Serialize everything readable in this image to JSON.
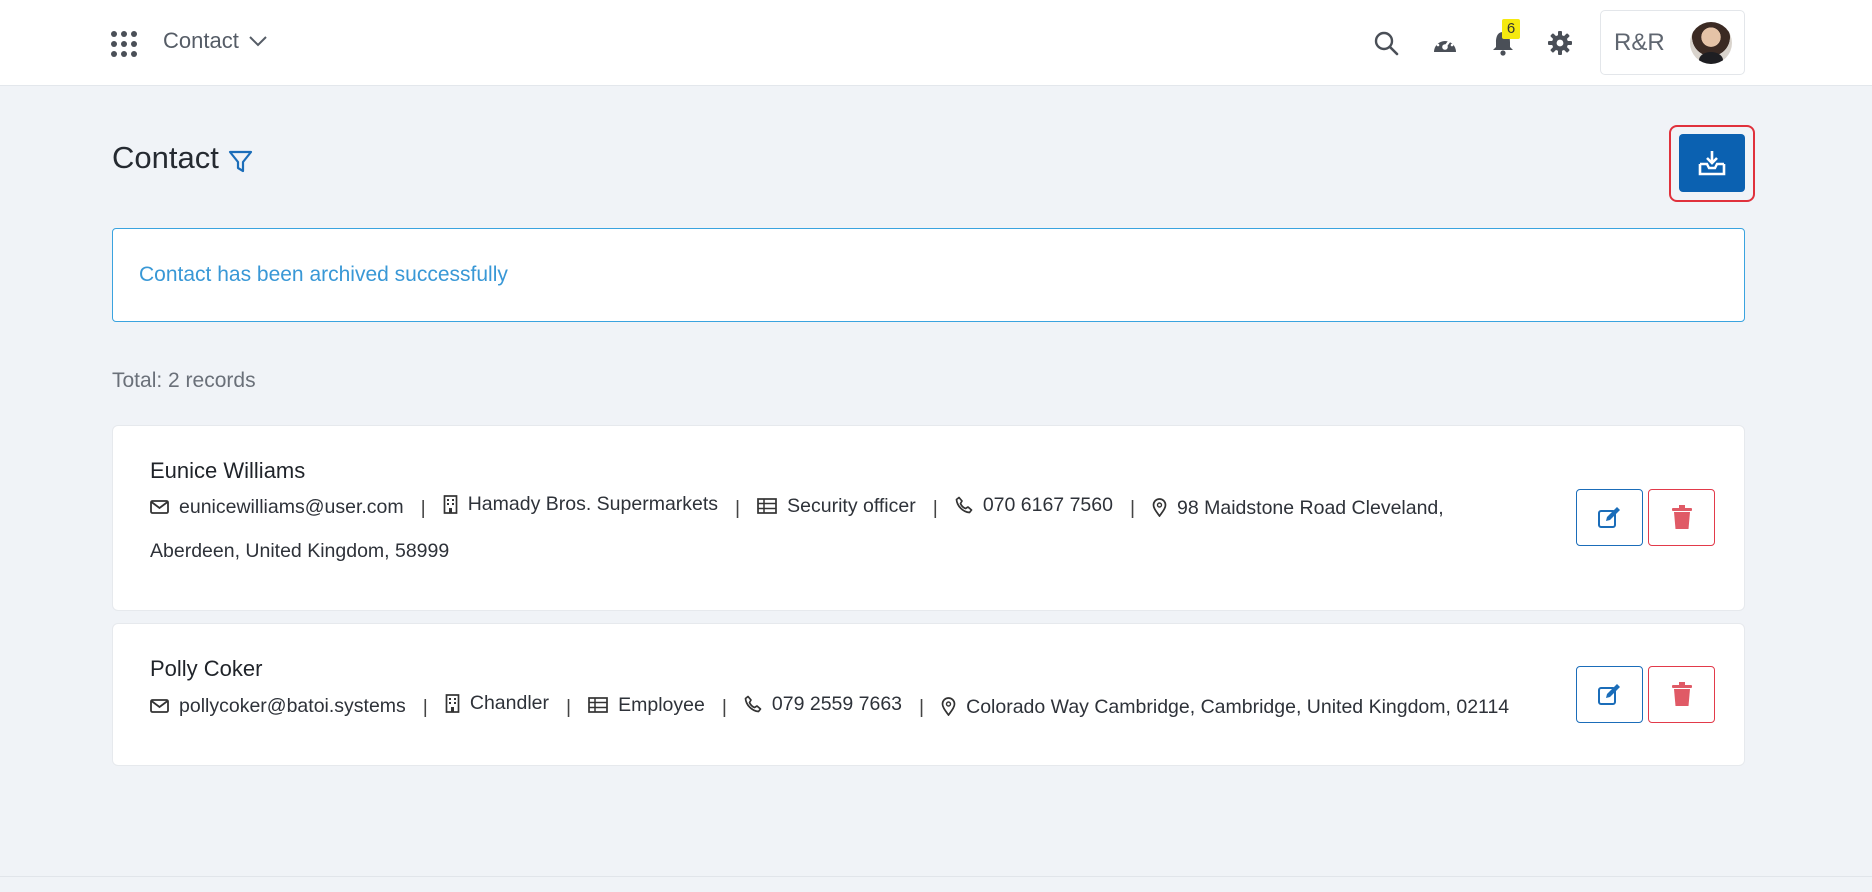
{
  "header": {
    "module": "Contact",
    "notification_count": "6",
    "org": "R&R"
  },
  "page": {
    "title": "Contact"
  },
  "alert": {
    "message": "Contact has been archived successfully"
  },
  "summary": {
    "total": "Total: 2 records"
  },
  "contacts": [
    {
      "name": "Eunice Williams",
      "email": "eunicewilliams@user.com",
      "company": "Hamady Bros. Supermarkets",
      "position": "Security officer",
      "phone": "070 6167 7560",
      "address": "98 Maidstone Road Cleveland, Aberdeen, United Kingdom, 58999"
    },
    {
      "name": "Polly Coker",
      "email": "pollycoker@batoi.systems",
      "company": "Chandler",
      "position": "Employee",
      "phone": "079 2559 7663",
      "address": "Colorado Way Cambridge, Cambridge, United Kingdom, 02114"
    }
  ],
  "colors": {
    "primary": "#0b61b1",
    "alert_text": "#3998d6",
    "danger": "#e23a4a",
    "badge": "#f5e90f"
  },
  "icons": [
    "apps-grid-icon",
    "chevron-down-icon",
    "search-icon",
    "dashboard-icon",
    "bell-icon",
    "gear-icon",
    "filter-icon",
    "download-icon",
    "envelope-icon",
    "building-icon",
    "table-icon",
    "phone-icon",
    "map-pin-icon",
    "edit-icon",
    "trash-icon"
  ]
}
